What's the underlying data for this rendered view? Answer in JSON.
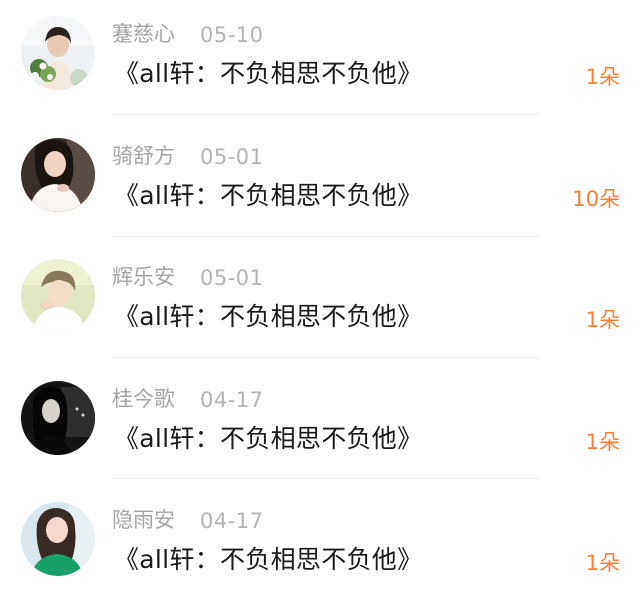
{
  "items": [
    {
      "username": "蹇慈心",
      "date": "05-10",
      "title": "《all轩：不负相思不负他》",
      "count": "1朵",
      "avatar_icon": "avatar-woman-flowers"
    },
    {
      "username": "骑舒方",
      "date": "05-01",
      "title": "《all轩：不负相思不负他》",
      "count": "10朵",
      "avatar_icon": "avatar-woman-white-dress"
    },
    {
      "username": "辉乐安",
      "date": "05-01",
      "title": "《all轩：不负相思不负他》",
      "count": "1朵",
      "avatar_icon": "avatar-person-light"
    },
    {
      "username": "桂今歌",
      "date": "04-17",
      "title": "《all轩：不负相思不负他》",
      "count": "1朵",
      "avatar_icon": "avatar-woman-dark"
    },
    {
      "username": "隐雨安",
      "date": "04-17",
      "title": "《all轩：不负相思不负他》",
      "count": "1朵",
      "avatar_icon": "avatar-woman-green"
    }
  ],
  "colors": {
    "username": "#a6a6a6",
    "date": "#b3b3b3",
    "title": "#1a1a1a",
    "count": "#ff7e33",
    "divider": "#f0f0f0"
  }
}
